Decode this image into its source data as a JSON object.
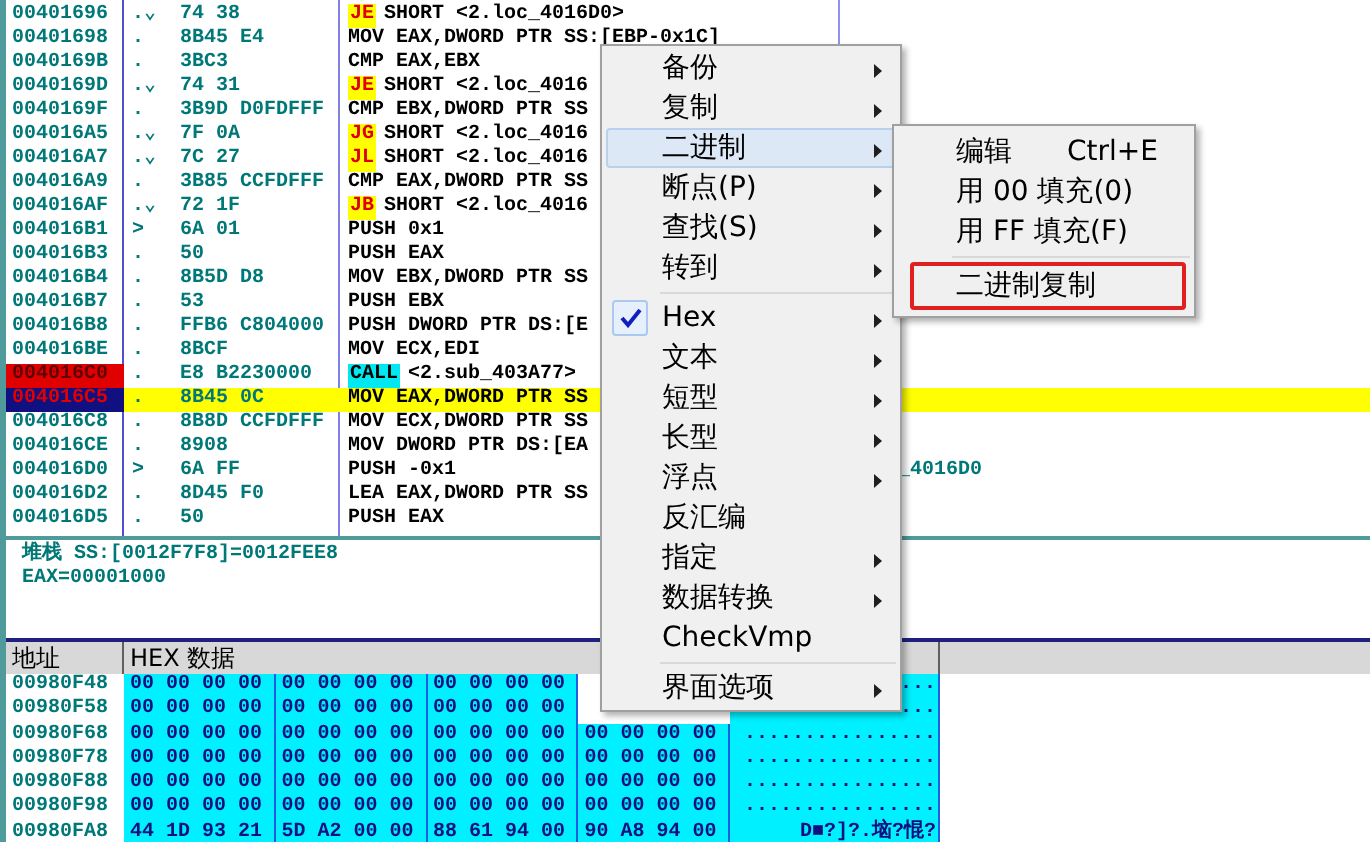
{
  "disassembly": {
    "rows": [
      {
        "address": "00401696",
        "arrow": ".⌄",
        "hex": "74 38",
        "kind": "jump",
        "mnemonic": "JE",
        "operands": "SHORT <2.loc_4016D0>",
        "breakpoint": false,
        "selected": false
      },
      {
        "address": "00401698",
        "arrow": ".",
        "hex": "8B45 E4",
        "kind": "plain",
        "instruction": "MOV EAX,DWORD PTR SS:[EBP-0x1C]",
        "breakpoint": false,
        "selected": false
      },
      {
        "address": "0040169B",
        "arrow": ".",
        "hex": "3BC3",
        "kind": "plain",
        "instruction": "CMP EAX,EBX",
        "breakpoint": false,
        "selected": false
      },
      {
        "address": "0040169D",
        "arrow": ".⌄",
        "hex": "74 31",
        "kind": "jump",
        "mnemonic": "JE",
        "operands": "SHORT <2.loc_4016",
        "breakpoint": false,
        "selected": false
      },
      {
        "address": "0040169F",
        "arrow": ".",
        "hex": "3B9D D0FDFFF",
        "kind": "plain",
        "instruction": "CMP EBX,DWORD PTR SS",
        "breakpoint": false,
        "selected": false
      },
      {
        "address": "004016A5",
        "arrow": ".⌄",
        "hex": "7F 0A",
        "kind": "jump",
        "mnemonic": "JG",
        "operands": "SHORT <2.loc_4016",
        "breakpoint": false,
        "selected": false
      },
      {
        "address": "004016A7",
        "arrow": ".⌄",
        "hex": "7C 27",
        "kind": "jump",
        "mnemonic": "JL",
        "operands": "SHORT <2.loc_4016",
        "breakpoint": false,
        "selected": false
      },
      {
        "address": "004016A9",
        "arrow": ".",
        "hex": "3B85 CCFDFFF",
        "kind": "plain",
        "instruction": "CMP EAX,DWORD PTR SS",
        "breakpoint": false,
        "selected": false
      },
      {
        "address": "004016AF",
        "arrow": ".⌄",
        "hex": "72 1F",
        "kind": "jump",
        "mnemonic": "JB",
        "operands": "SHORT <2.loc_4016",
        "breakpoint": false,
        "selected": false
      },
      {
        "address": "004016B1",
        "arrow": ">",
        "hex": "6A 01",
        "kind": "plain",
        "instruction": "PUSH 0x1",
        "breakpoint": false,
        "selected": false
      },
      {
        "address": "004016B3",
        "arrow": ".",
        "hex": "50",
        "kind": "plain",
        "instruction": "PUSH EAX",
        "breakpoint": false,
        "selected": false
      },
      {
        "address": "004016B4",
        "arrow": ".",
        "hex": "8B5D D8",
        "kind": "plain",
        "instruction": "MOV EBX,DWORD PTR SS",
        "breakpoint": false,
        "selected": false
      },
      {
        "address": "004016B7",
        "arrow": ".",
        "hex": "53",
        "kind": "plain",
        "instruction": "PUSH EBX",
        "breakpoint": false,
        "selected": false
      },
      {
        "address": "004016B8",
        "arrow": ".",
        "hex": "FFB6 C804000",
        "kind": "plain",
        "instruction": "PUSH DWORD PTR DS:[E",
        "breakpoint": false,
        "selected": false
      },
      {
        "address": "004016BE",
        "arrow": ".",
        "hex": "8BCF",
        "kind": "plain",
        "instruction": "MOV ECX,EDI",
        "breakpoint": false,
        "selected": false
      },
      {
        "address": "004016C0",
        "arrow": ".",
        "hex": "E8 B2230000",
        "kind": "call",
        "mnemonic": "CALL",
        "operands": "<2.sub_403A77>",
        "breakpoint": true,
        "selected": false
      },
      {
        "address": "004016C5",
        "arrow": ".",
        "hex": "8B45 0C",
        "kind": "plain",
        "instruction": "MOV EAX,DWORD PTR SS",
        "breakpoint": false,
        "selected": true
      },
      {
        "address": "004016C8",
        "arrow": ".",
        "hex": "8B8D CCFDFFF",
        "kind": "plain",
        "instruction": "MOV ECX,DWORD PTR SS",
        "breakpoint": false,
        "selected": false
      },
      {
        "address": "004016CE",
        "arrow": ".",
        "hex": "8908",
        "kind": "plain",
        "instruction": "MOV DWORD PTR DS:[EA",
        "breakpoint": false,
        "selected": false
      },
      {
        "address": "004016D0",
        "arrow": ">",
        "hex": "6A FF",
        "kind": "plain",
        "instruction": "PUSH -0x1",
        "comment": "_4016D0",
        "breakpoint": false,
        "selected": false
      },
      {
        "address": "004016D2",
        "arrow": ".",
        "hex": "8D45 F0",
        "kind": "plain",
        "instruction": "LEA EAX,DWORD PTR SS",
        "breakpoint": false,
        "selected": false
      },
      {
        "address": "004016D5",
        "arrow": ".",
        "hex": "50",
        "kind": "plain",
        "instruction": "PUSH EAX",
        "breakpoint": false,
        "selected": false
      }
    ]
  },
  "info": {
    "lines": [
      "堆栈 SS:[0012F7F8]=0012FEE8",
      "EAX=00001000"
    ]
  },
  "dump": {
    "columns": [
      "地址",
      "HEX 数据"
    ],
    "rows": [
      {
        "address": "00980F48",
        "groups": [
          "00 00 00 00",
          "00 00 00 00",
          "00 00 00 00"
        ],
        "ascii": "..."
      },
      {
        "address": "00980F58",
        "groups": [
          "00 00 00 00",
          "00 00 00 00",
          "00 00 00 00"
        ],
        "ascii": "..."
      },
      {
        "address": "00980F68",
        "groups": [
          "00 00 00 00",
          "00 00 00 00",
          "00 00 00 00",
          "00 00 00 00"
        ],
        "ascii": "................"
      },
      {
        "address": "00980F78",
        "groups": [
          "00 00 00 00",
          "00 00 00 00",
          "00 00 00 00",
          "00 00 00 00"
        ],
        "ascii": "................"
      },
      {
        "address": "00980F88",
        "groups": [
          "00 00 00 00",
          "00 00 00 00",
          "00 00 00 00",
          "00 00 00 00"
        ],
        "ascii": "................"
      },
      {
        "address": "00980F98",
        "groups": [
          "00 00 00 00",
          "00 00 00 00",
          "00 00 00 00",
          "00 00 00 00"
        ],
        "ascii": "................"
      },
      {
        "address": "00980FA8",
        "groups": [
          "44 1D 93 21",
          "5D A2 00 00",
          "88 61 94 00",
          "90 A8 94 00"
        ],
        "ascii": "D■?]?.垴?惃?"
      }
    ]
  },
  "context_menu": {
    "items": [
      {
        "kind": "item",
        "label": "备份",
        "submenu": true,
        "checked": false,
        "selected": false
      },
      {
        "kind": "item",
        "label": "复制",
        "submenu": true,
        "checked": false,
        "selected": false
      },
      {
        "kind": "item",
        "label": "二进制",
        "submenu": true,
        "checked": false,
        "selected": true
      },
      {
        "kind": "item",
        "label": "断点(P)",
        "submenu": true,
        "checked": false,
        "selected": false
      },
      {
        "kind": "item",
        "label": "查找(S)",
        "submenu": true,
        "checked": false,
        "selected": false
      },
      {
        "kind": "item",
        "label": "转到",
        "submenu": true,
        "checked": false,
        "selected": false
      },
      {
        "kind": "separator"
      },
      {
        "kind": "item",
        "label": "Hex",
        "submenu": true,
        "checked": true,
        "selected": false
      },
      {
        "kind": "item",
        "label": "文本",
        "submenu": true,
        "checked": false,
        "selected": false
      },
      {
        "kind": "item",
        "label": "短型",
        "submenu": true,
        "checked": false,
        "selected": false
      },
      {
        "kind": "item",
        "label": "长型",
        "submenu": true,
        "checked": false,
        "selected": false
      },
      {
        "kind": "item",
        "label": "浮点",
        "submenu": true,
        "checked": false,
        "selected": false
      },
      {
        "kind": "item",
        "label": "反汇编",
        "submenu": false,
        "checked": false,
        "selected": false
      },
      {
        "kind": "item",
        "label": "指定",
        "submenu": true,
        "checked": false,
        "selected": false
      },
      {
        "kind": "item",
        "label": "数据转换",
        "submenu": true,
        "checked": false,
        "selected": false
      },
      {
        "kind": "item",
        "label": "CheckVmp",
        "submenu": false,
        "checked": false,
        "selected": false
      },
      {
        "kind": "separator"
      },
      {
        "kind": "item",
        "label": "界面选项",
        "submenu": true,
        "checked": false,
        "selected": false
      }
    ]
  },
  "submenu": {
    "items": [
      {
        "kind": "item",
        "label": "编辑",
        "shortcut": "Ctrl+E",
        "outlined": false
      },
      {
        "kind": "item",
        "label": "用 00 填充(0)",
        "outlined": false
      },
      {
        "kind": "item",
        "label": "用 FF 填充(F)",
        "outlined": false
      },
      {
        "kind": "separator"
      },
      {
        "kind": "item",
        "label": "二进制复制",
        "outlined": true
      }
    ]
  }
}
